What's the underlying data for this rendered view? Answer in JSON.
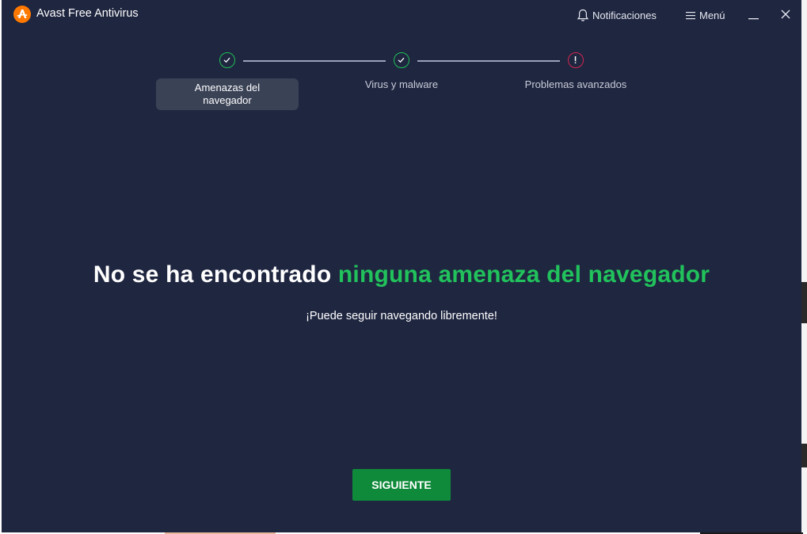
{
  "app": {
    "title": "Avast Free Antivirus",
    "brand_color": "#ff7800",
    "logo_icon": "avast-logo-icon"
  },
  "header": {
    "notifications_label": "Notificaciones",
    "notifications_icon": "bell-icon",
    "menu_label": "Menú",
    "menu_icon": "hamburger-icon",
    "minimize_icon": "minimize-icon",
    "close_icon": "close-icon"
  },
  "steps": [
    {
      "label_line1": "Amenazas del",
      "label_line2": "navegador",
      "status": "done",
      "active": true,
      "icon": "check-icon"
    },
    {
      "label": "Virus y malware",
      "status": "done",
      "active": false,
      "icon": "check-icon"
    },
    {
      "label": "Problemas avanzados",
      "status": "warning",
      "active": false,
      "icon": "exclamation-icon"
    }
  ],
  "result": {
    "headline_prefix": "No se ha encontrado ",
    "headline_highlight": "ninguna amenaza del navegador",
    "subtext": "¡Puede seguir navegando libremente!",
    "highlight_color": "#21c25c"
  },
  "actions": {
    "next_label": "SIGUIENTE"
  },
  "colors": {
    "background": "#1f2640",
    "success": "#1fbf55",
    "warning": "#d4264f",
    "button": "#0e8a3a"
  }
}
